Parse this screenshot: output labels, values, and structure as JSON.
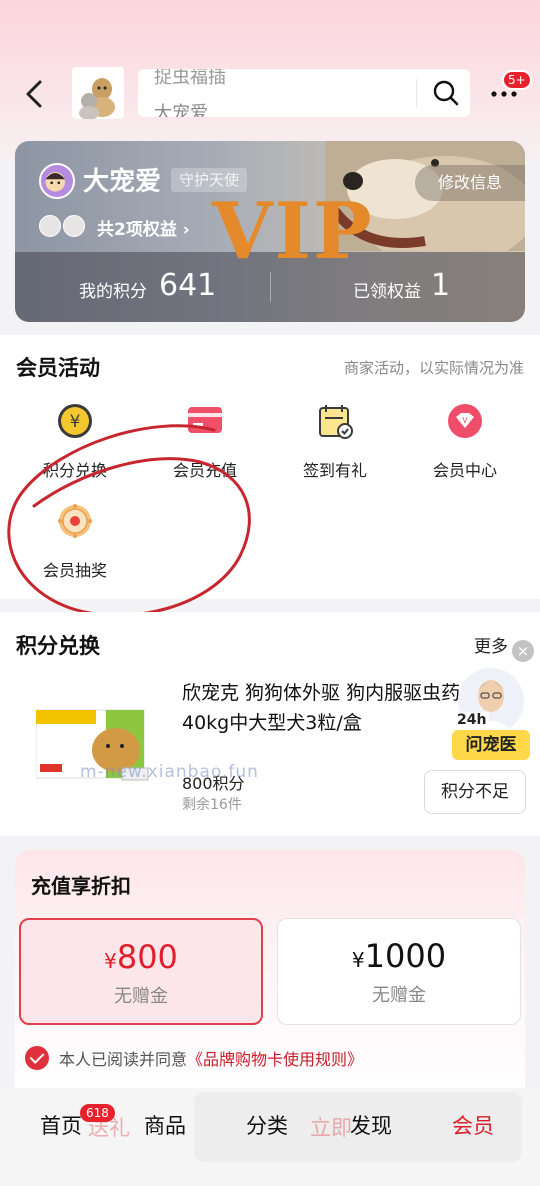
{
  "header": {
    "search_ghost_text": "捉虫福插",
    "search_text": "大宠爱",
    "more_badge": "5+"
  },
  "vip_card": {
    "member_name": "大宠爱",
    "member_level": "守护天使",
    "edit_info": "修改信息",
    "rights_link": "共2项权益 ›",
    "vip_word": "VIP",
    "points_label": "我的积分",
    "points_value": "641",
    "rights_label": "已领权益",
    "rights_value": "1"
  },
  "activity": {
    "title": "会员活动",
    "note": "商家活动，以实际情况为准",
    "items": [
      {
        "label": "积分兑换",
        "icon": "coin-yen-icon"
      },
      {
        "label": "会员充值",
        "icon": "card-icon"
      },
      {
        "label": "签到有礼",
        "icon": "calendar-check-icon"
      },
      {
        "label": "会员中心",
        "icon": "vip-badge-icon"
      },
      {
        "label": "会员抽奖",
        "icon": "lottery-wheel-icon"
      }
    ]
  },
  "exchange": {
    "title": "积分兑换",
    "more": "更多 ›",
    "product_title": "欣宠克 狗狗体外驱 狗内服驱虫药 0.1-40kg中大型犬3粒/盒",
    "product_points": "800积分",
    "product_stock": "剩余16件",
    "product_button": "积分不足",
    "watermark": "m-new.xianbao.fun",
    "vet_24h": "24h",
    "vet_label": "问宠医",
    "close": "×"
  },
  "recharge": {
    "title": "充值享折扣",
    "options": [
      {
        "currency": "¥",
        "amount": "800",
        "gift": "无赠金"
      },
      {
        "currency": "¥",
        "amount": "1000",
        "gift": "无赠金"
      }
    ],
    "agree_text": "本人已阅读并同意",
    "agree_link": "《品牌购物卡使用规则》"
  },
  "bottom_nav": {
    "home": "首页",
    "home_badge": "618",
    "products": "商品",
    "category": "分类",
    "discover": "发现",
    "member": "会员",
    "ghost_1": "送礼",
    "ghost_2": "立即"
  },
  "colors": {
    "accent_red": "#e11f2b",
    "vip_gold": "#e48a2a"
  }
}
